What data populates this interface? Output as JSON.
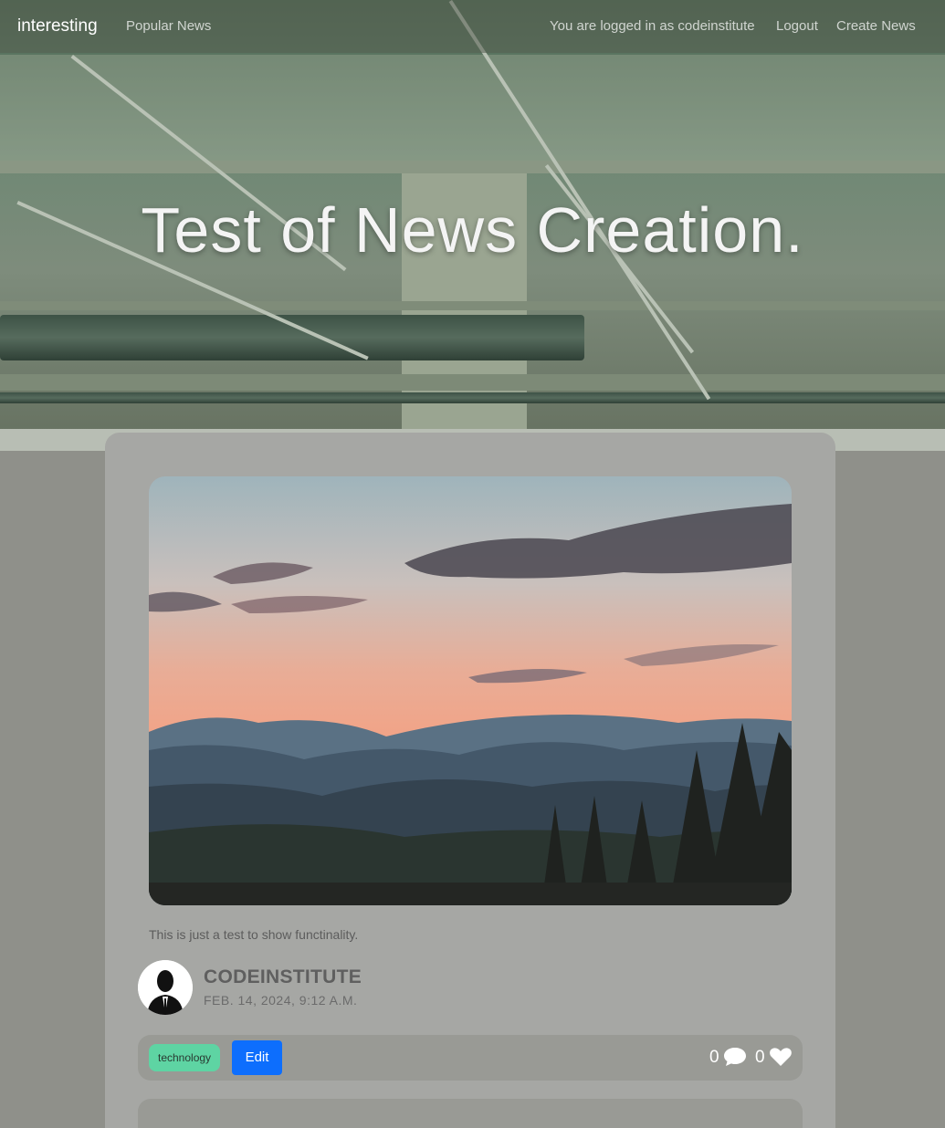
{
  "navbar": {
    "brand": "interesting",
    "popular_news": "Popular News",
    "logged_in_text": "You are logged in as codeinstitute",
    "logout": "Logout",
    "create_news": "Create News"
  },
  "hero": {
    "title": "Test of News Creation."
  },
  "post": {
    "excerpt": "This is just a test to show functinality.",
    "author": "CODEINSTITUTE",
    "date": "FEB. 14, 2024, 9:12 A.M.",
    "tag": "technology",
    "edit_label": "Edit",
    "comment_count": "0",
    "like_count": "0"
  },
  "icons": {
    "comment": "comment-icon",
    "like": "heart-icon",
    "avatar": "avatar-silhouette"
  },
  "colors": {
    "page_background": "#8f908a",
    "card_background": "#a6a7a4",
    "tag_background": "#5ed4a3",
    "edit_button": "#0d6efd"
  }
}
